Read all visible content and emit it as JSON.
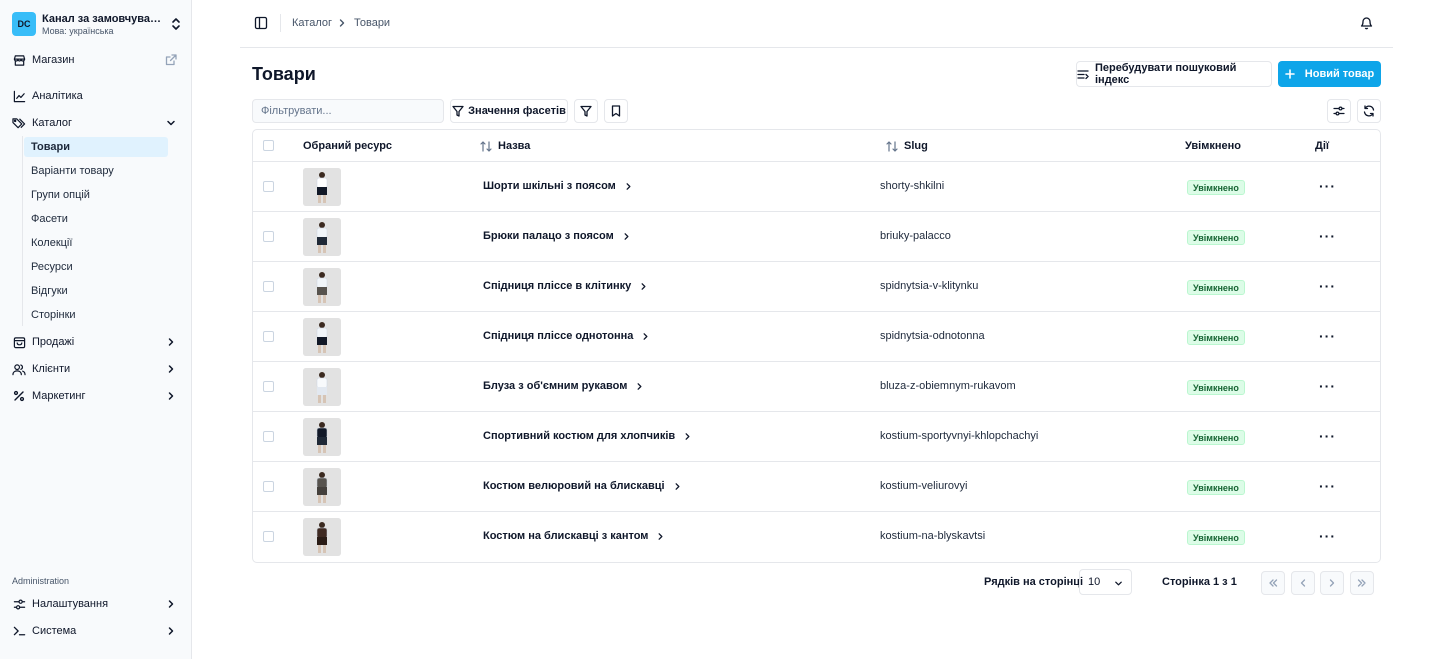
{
  "sidebar": {
    "channel": {
      "initials": "DC",
      "name": "Канал за замовчуван...",
      "language": "Мова: українська"
    },
    "store_label": "Магазин",
    "analytics_label": "Аналітика",
    "catalog_label": "Каталог",
    "catalog_items": [
      "Товари",
      "Варіанти товару",
      "Групи опцій",
      "Фасети",
      "Колекції",
      "Ресурси",
      "Відгуки",
      "Сторінки"
    ],
    "sales_label": "Продажі",
    "customers_label": "Клієнти",
    "marketing_label": "Маркетинг",
    "admin_section": "Administration",
    "settings_label": "Налаштування",
    "system_label": "Система"
  },
  "breadcrumb": {
    "parent": "Каталог",
    "current": "Товари"
  },
  "page": {
    "title": "Товари",
    "rebuild_label": "Перебудувати пошуковий індекс",
    "new_product_label": "Новий товар",
    "filter_placeholder": "Фільтрувати...",
    "facet_values_label": "Значення фасетів"
  },
  "table": {
    "columns": {
      "asset": "Обраний ресурс",
      "name": "Назва",
      "slug": "Slug",
      "enabled": "Увімкнено",
      "actions": "Дії"
    },
    "rows": [
      {
        "name": "Шорти шкільні з поясом",
        "slug": "shorty-shkilni",
        "status": "Увімкнено"
      },
      {
        "name": "Брюки палацо з поясом",
        "slug": "briuky-palacco",
        "status": "Увімкнено"
      },
      {
        "name": "Спідниця пліссе в клітинку",
        "slug": "spidnytsia-v-klitynku",
        "status": "Увімкнено"
      },
      {
        "name": "Спідниця пліссе однотонна",
        "slug": "spidnytsia-odnotonna",
        "status": "Увімкнено"
      },
      {
        "name": "Блуза з об'ємним рукавом",
        "slug": "bluza-z-obiemnym-rukavom",
        "status": "Увімкнено"
      },
      {
        "name": "Спортивний костюм для хлопчиків",
        "slug": "kostium-sportyvnyi-khlopchachyi",
        "status": "Увімкнено"
      },
      {
        "name": "Костюм велюровий на блискавці",
        "slug": "kostium-veliurovyi",
        "status": "Увімкнено"
      },
      {
        "name": "Костюм на блискавці з кантом",
        "slug": "kostium-na-blyskavtsi",
        "status": "Увімкнено"
      }
    ]
  },
  "pagination": {
    "rows_label": "Рядків на сторінці",
    "rows_value": "10",
    "page_label": "Сторінка 1 з 1"
  },
  "colors": {
    "accent": "#0ea5e9",
    "active_bg": "#e0f2fe",
    "badge_bg": "#dcfce7",
    "badge_text": "#166534"
  }
}
